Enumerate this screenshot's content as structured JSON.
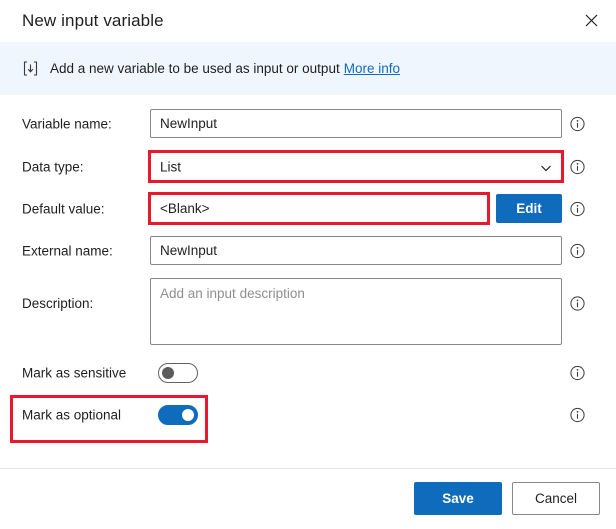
{
  "dialog": {
    "title": "New input variable",
    "close_icon": "close-icon"
  },
  "banner": {
    "icon": "input-variable-icon",
    "text": "Add a new variable to be used as input or output",
    "link_label": "More info"
  },
  "form": {
    "fields": [
      {
        "label": "Variable name:",
        "value": "NewInput",
        "placeholder": "",
        "info_icon": "info-icon"
      },
      {
        "label": "Data type:",
        "value": "List",
        "chevron_icon": "chevron-down-icon",
        "info_icon": "info-icon"
      },
      {
        "label": "Default value:",
        "value": "<Blank>",
        "edit_label": "Edit",
        "info_icon": "info-icon"
      },
      {
        "label": "External name:",
        "value": "NewInput",
        "placeholder": "",
        "info_icon": "info-icon"
      },
      {
        "label": "Description:",
        "value": "",
        "placeholder": "Add an input description",
        "info_icon": "info-icon"
      }
    ],
    "toggles": [
      {
        "label": "Mark as sensitive",
        "state": "off",
        "info_icon": "info-icon"
      },
      {
        "label": "Mark as optional",
        "state": "on",
        "info_icon": "info-icon"
      }
    ]
  },
  "footer": {
    "save_label": "Save",
    "cancel_label": "Cancel"
  },
  "colors": {
    "accent": "#0f6cbd",
    "highlight": "#e8192c",
    "banner_bg": "#eff6fd",
    "border": "#8a8886"
  }
}
